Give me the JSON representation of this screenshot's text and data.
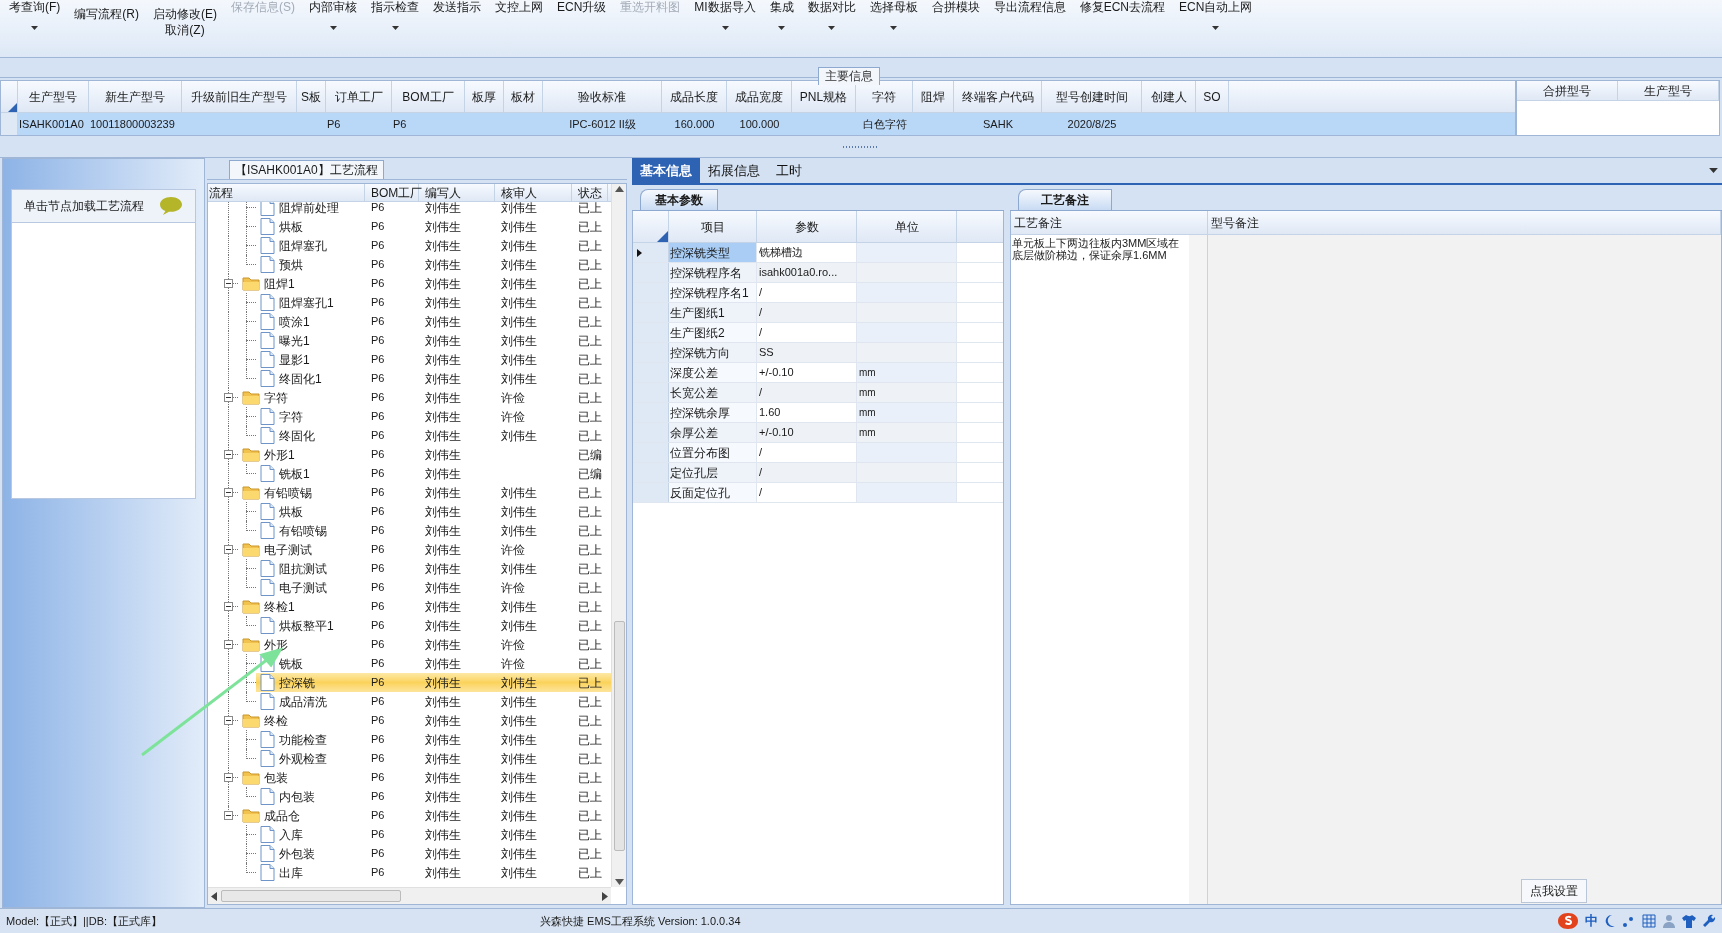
{
  "toolbar": {
    "items": [
      {
        "label": "考查询(F)",
        "kind": "cut",
        "disabled": false,
        "dropdown": true
      },
      {
        "label": "编写流程(R)",
        "kind": "full",
        "disabled": false,
        "dropdown": false
      },
      {
        "label": "启动修改(E)",
        "second_label": "取消(Z)",
        "kind": "full",
        "disabled": false,
        "dropdown": false
      },
      {
        "label": "保存信息(S)",
        "kind": "cut",
        "disabled": true,
        "dropdown": false
      },
      {
        "label": "内部审核",
        "kind": "cut",
        "disabled": false,
        "dropdown": true
      },
      {
        "label": "指示检查",
        "kind": "cut",
        "disabled": false,
        "dropdown": true
      },
      {
        "label": "发送指示",
        "kind": "cut",
        "disabled": false,
        "dropdown": false
      },
      {
        "label": "文控上网",
        "kind": "cut",
        "disabled": false,
        "dropdown": false
      },
      {
        "label": "ECN升级",
        "kind": "cut",
        "disabled": false,
        "dropdown": false
      },
      {
        "label": "重选开料图",
        "kind": "cut",
        "disabled": true,
        "dropdown": false
      },
      {
        "label": "MI数据导入",
        "kind": "cut",
        "disabled": false,
        "dropdown": true
      },
      {
        "label": "集成",
        "kind": "cut",
        "disabled": false,
        "dropdown": true
      },
      {
        "label": "数据对比",
        "kind": "cut",
        "disabled": false,
        "dropdown": true
      },
      {
        "label": "选择母板",
        "kind": "cut",
        "disabled": false,
        "dropdown": true
      },
      {
        "label": "合拼模块",
        "kind": "cut",
        "disabled": false,
        "dropdown": false
      },
      {
        "label": "导出流程信息",
        "kind": "cut",
        "disabled": false,
        "dropdown": false
      },
      {
        "label": "修复ECN去流程",
        "kind": "cut",
        "disabled": false,
        "dropdown": false
      },
      {
        "label": "ECN自动上网",
        "kind": "cut",
        "disabled": false,
        "dropdown": true
      }
    ]
  },
  "main_info": {
    "title": "主要信息",
    "columns": [
      "生产型号",
      "新生产型号",
      "升级前旧生产型号",
      "S板",
      "订单工厂",
      "BOM工厂",
      "板厚",
      "板材",
      "验收标准",
      "成品长度",
      "成品宽度",
      "PNL规格",
      "字符",
      "阻焊",
      "终端客户代码",
      "型号创建时间",
      "创建人",
      "SO"
    ],
    "rows": [
      {
        "selected": true,
        "cells": [
          "ISAHK001A0",
          "10011800003239",
          null,
          null,
          "P6",
          "P6",
          null,
          null,
          "IPC-6012 II级",
          "160.000",
          "100.000",
          null,
          "白色字符",
          null,
          "SAHK",
          "2020/8/25",
          null,
          null
        ]
      }
    ]
  },
  "merge_grid": {
    "columns": [
      "合拼型号",
      "生产型号"
    ]
  },
  "flow": {
    "title": "【ISAHK001A0】工艺流程",
    "hint": "单击节点加载工艺流程",
    "columns": [
      "流程",
      "BOM工厂",
      "编写人",
      "核审人",
      "状态"
    ],
    "continued_children": [
      {
        "label": "阻焊前处理",
        "bom": "P6",
        "writer": "刘伟生",
        "reviewer": "刘伟生",
        "status": "已上",
        "selected": false
      },
      {
        "label": "烘板",
        "bom": "P6",
        "writer": "刘伟生",
        "reviewer": "刘伟生",
        "status": "已上",
        "selected": false
      },
      {
        "label": "阻焊塞孔",
        "bom": "P6",
        "writer": "刘伟生",
        "reviewer": "刘伟生",
        "status": "已上",
        "selected": false
      },
      {
        "label": "预烘",
        "bom": "P6",
        "writer": "刘伟生",
        "reviewer": "刘伟生",
        "status": "已上",
        "selected": false
      }
    ],
    "nodes": [
      {
        "label": "阻焊1",
        "bom": "P6",
        "writer": "刘伟生",
        "reviewer": "刘伟生",
        "status": "已上",
        "selected": false,
        "expanded": true,
        "children": [
          {
            "label": "阻焊塞孔1",
            "bom": "P6",
            "writer": "刘伟生",
            "reviewer": "刘伟生",
            "status": "已上",
            "selected": false
          },
          {
            "label": "喷涂1",
            "bom": "P6",
            "writer": "刘伟生",
            "reviewer": "刘伟生",
            "status": "已上",
            "selected": false
          },
          {
            "label": "曝光1",
            "bom": "P6",
            "writer": "刘伟生",
            "reviewer": "刘伟生",
            "status": "已上",
            "selected": false
          },
          {
            "label": "显影1",
            "bom": "P6",
            "writer": "刘伟生",
            "reviewer": "刘伟生",
            "status": "已上",
            "selected": false
          },
          {
            "label": "终固化1",
            "bom": "P6",
            "writer": "刘伟生",
            "reviewer": "刘伟生",
            "status": "已上",
            "selected": false
          }
        ]
      },
      {
        "label": "字符",
        "bom": "P6",
        "writer": "刘伟生",
        "reviewer": "许俭",
        "status": "已上",
        "selected": false,
        "expanded": true,
        "children": [
          {
            "label": "字符",
            "bom": "P6",
            "writer": "刘伟生",
            "reviewer": "许俭",
            "status": "已上",
            "selected": false
          },
          {
            "label": "终固化",
            "bom": "P6",
            "writer": "刘伟生",
            "reviewer": "刘伟生",
            "status": "已上",
            "selected": false
          }
        ]
      },
      {
        "label": "外形1",
        "bom": "P6",
        "writer": "刘伟生",
        "status": "已编",
        "selected": false,
        "expanded": true,
        "children": [
          {
            "label": "铣板1",
            "bom": "P6",
            "writer": "刘伟生",
            "status": "已编",
            "selected": false
          }
        ]
      },
      {
        "label": "有铅喷锡",
        "bom": "P6",
        "writer": "刘伟生",
        "reviewer": "刘伟生",
        "status": "已上",
        "selected": false,
        "expanded": true,
        "children": [
          {
            "label": "烘板",
            "bom": "P6",
            "writer": "刘伟生",
            "reviewer": "刘伟生",
            "status": "已上",
            "selected": false
          },
          {
            "label": "有铅喷锡",
            "bom": "P6",
            "writer": "刘伟生",
            "reviewer": "刘伟生",
            "status": "已上",
            "selected": false
          }
        ]
      },
      {
        "label": "电子测试",
        "bom": "P6",
        "writer": "刘伟生",
        "reviewer": "许俭",
        "status": "已上",
        "selected": false,
        "expanded": true,
        "children": [
          {
            "label": "阻抗测试",
            "bom": "P6",
            "writer": "刘伟生",
            "reviewer": "刘伟生",
            "status": "已上",
            "selected": false
          },
          {
            "label": "电子测试",
            "bom": "P6",
            "writer": "刘伟生",
            "reviewer": "许俭",
            "status": "已上",
            "selected": false
          }
        ]
      },
      {
        "label": "终检1",
        "bom": "P6",
        "writer": "刘伟生",
        "reviewer": "刘伟生",
        "status": "已上",
        "selected": false,
        "expanded": true,
        "children": [
          {
            "label": "烘板整平1",
            "bom": "P6",
            "writer": "刘伟生",
            "reviewer": "刘伟生",
            "status": "已上",
            "selected": false
          }
        ]
      },
      {
        "label": "外形",
        "bom": "P6",
        "writer": "刘伟生",
        "reviewer": "许俭",
        "status": "已上",
        "selected": false,
        "expanded": true,
        "children": [
          {
            "label": "铣板",
            "bom": "P6",
            "writer": "刘伟生",
            "reviewer": "许俭",
            "status": "已上",
            "selected": false
          },
          {
            "label": "控深铣",
            "bom": "P6",
            "writer": "刘伟生",
            "reviewer": "刘伟生",
            "status": "已上",
            "selected": true
          },
          {
            "label": "成品清洗",
            "bom": "P6",
            "writer": "刘伟生",
            "reviewer": "刘伟生",
            "status": "已上",
            "selected": false
          }
        ]
      },
      {
        "label": "终检",
        "bom": "P6",
        "writer": "刘伟生",
        "reviewer": "刘伟生",
        "status": "已上",
        "selected": false,
        "expanded": true,
        "children": [
          {
            "label": "功能检查",
            "bom": "P6",
            "writer": "刘伟生",
            "reviewer": "刘伟生",
            "status": "已上",
            "selected": false
          },
          {
            "label": "外观检查",
            "bom": "P6",
            "writer": "刘伟生",
            "reviewer": "刘伟生",
            "status": "已上",
            "selected": false
          }
        ]
      },
      {
        "label": "包装",
        "bom": "P6",
        "writer": "刘伟生",
        "reviewer": "刘伟生",
        "status": "已上",
        "selected": false,
        "expanded": true,
        "children": [
          {
            "label": "内包装",
            "bom": "P6",
            "writer": "刘伟生",
            "reviewer": "刘伟生",
            "status": "已上",
            "selected": false
          }
        ]
      },
      {
        "label": "成品仓",
        "bom": "P6",
        "writer": "刘伟生",
        "reviewer": "刘伟生",
        "status": "已上",
        "selected": false,
        "expanded": true,
        "children": [
          {
            "label": "入库",
            "bom": "P6",
            "writer": "刘伟生",
            "reviewer": "刘伟生",
            "status": "已上",
            "selected": false
          },
          {
            "label": "外包装",
            "bom": "P6",
            "writer": "刘伟生",
            "reviewer": "刘伟生",
            "status": "已上",
            "selected": false
          },
          {
            "label": "出库",
            "bom": "P6",
            "writer": "刘伟生",
            "reviewer": "刘伟生",
            "status": "已上",
            "selected": false
          }
        ]
      }
    ]
  },
  "detail": {
    "tabs": [
      {
        "label": "基本信息",
        "selected": true
      },
      {
        "label": "拓展信息",
        "selected": false
      },
      {
        "label": "工时",
        "selected": false
      }
    ],
    "params": {
      "title": "基本参数",
      "columns": [
        "项目",
        "参数",
        "单位"
      ],
      "rows": [
        {
          "item": "控深铣类型",
          "value": "铣梯槽边",
          "current": true
        },
        {
          "item": "控深铣程序名",
          "value": "isahk001a0.ro...",
          "current": false
        },
        {
          "item": "控深铣程序名1",
          "value": "/",
          "current": false
        },
        {
          "item": "生产图纸1",
          "value": "/",
          "current": false
        },
        {
          "item": "生产图纸2",
          "value": "/",
          "current": false
        },
        {
          "item": "控深铣方向",
          "value": "SS",
          "current": false
        },
        {
          "item": "深度公差",
          "value": "+/-0.10",
          "unit": "mm",
          "current": false
        },
        {
          "item": "长宽公差",
          "value": "/",
          "unit": "mm",
          "current": false
        },
        {
          "item": "控深铣余厚",
          "value": "1.60",
          "unit": "mm",
          "current": false
        },
        {
          "item": "余厚公差",
          "value": "+/-0.10",
          "unit": "mm",
          "current": false
        },
        {
          "item": "位置分布图",
          "value": "/",
          "current": false
        },
        {
          "item": "定位孔层",
          "value": "/",
          "current": false
        },
        {
          "item": "反面定位孔",
          "value": "/",
          "current": false
        }
      ]
    },
    "notes": {
      "title": "工艺备注",
      "columns": [
        "工艺备注",
        "型号备注"
      ],
      "process_note": "单元板上下两边往板内3MM区域在底层做阶梯边，保证余厚1.6MM"
    }
  },
  "settings_button": "点我设置",
  "status_bar": {
    "left": "Model:【正式】||DB:【正式库】",
    "center": "兴森快捷 EMS工程系统 Version: 1.0.0.34"
  },
  "tray": {
    "ime": "中"
  }
}
